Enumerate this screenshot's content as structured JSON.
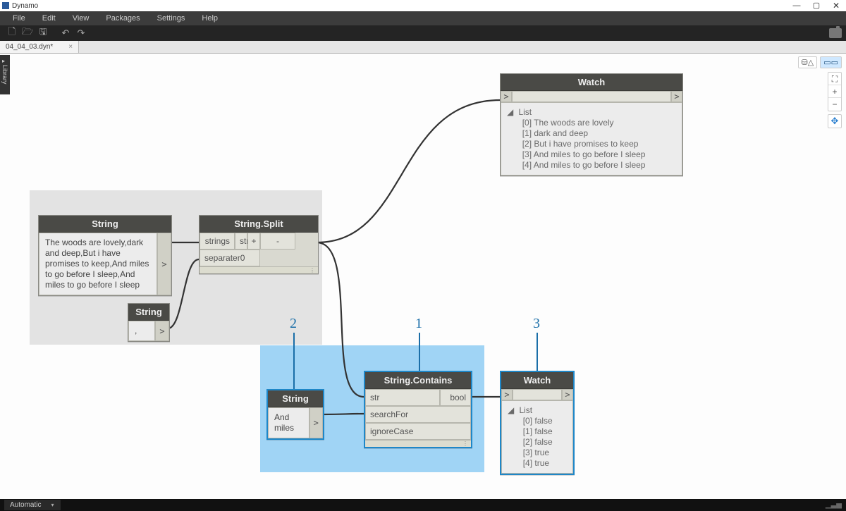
{
  "app_title": "Dynamo",
  "window_controls": {
    "min": "—",
    "max": "▢",
    "close": "✕"
  },
  "menu": [
    "File",
    "Edit",
    "View",
    "Packages",
    "Settings",
    "Help"
  ],
  "toolbar": {
    "new": "🗋",
    "open": "🗁",
    "save": "🖫",
    "undo": "↶",
    "redo": "↷",
    "camera": "camera"
  },
  "tab": {
    "label": "04_04_03.dyn*",
    "close": "×"
  },
  "library_label": "Library",
  "viewtools": {
    "geo": "⛁△",
    "nodes": "▭▭"
  },
  "zoom": {
    "fit": "⛶",
    "in": "+",
    "out": "−",
    "home": "✥"
  },
  "annotations": {
    "a1": "1",
    "a2": "2",
    "a3": "3"
  },
  "port_label": ">",
  "plus": "+",
  "minus": "-",
  "list_caret": "◢",
  "nodes": {
    "string_main": {
      "title": "String",
      "value": "The woods are lovely,dark and deep,But i have promises to keep,And miles to go before I sleep,And miles to go before I sleep"
    },
    "string_sep": {
      "title": "String",
      "value": ","
    },
    "split": {
      "title": "String.Split",
      "in1": "str",
      "in2": "separater0",
      "out": "strings"
    },
    "watch_top": {
      "title": "Watch",
      "header": "List",
      "items": [
        "[0] The woods are lovely",
        "[1] dark and deep",
        "[2] But i have promises to keep",
        "[3] And miles to go before I sleep",
        "[4] And miles to go before I sleep"
      ]
    },
    "string_search": {
      "title": "String",
      "value": "And miles"
    },
    "contains": {
      "title": "String.Contains",
      "in1": "str",
      "in2": "searchFor",
      "in3": "ignoreCase",
      "out": "bool"
    },
    "watch_bottom": {
      "title": "Watch",
      "header": "List",
      "items": [
        "[0] false",
        "[1] false",
        "[2] false",
        "[3] true",
        "[4] true"
      ]
    }
  },
  "status": {
    "run_mode": "Automatic"
  }
}
